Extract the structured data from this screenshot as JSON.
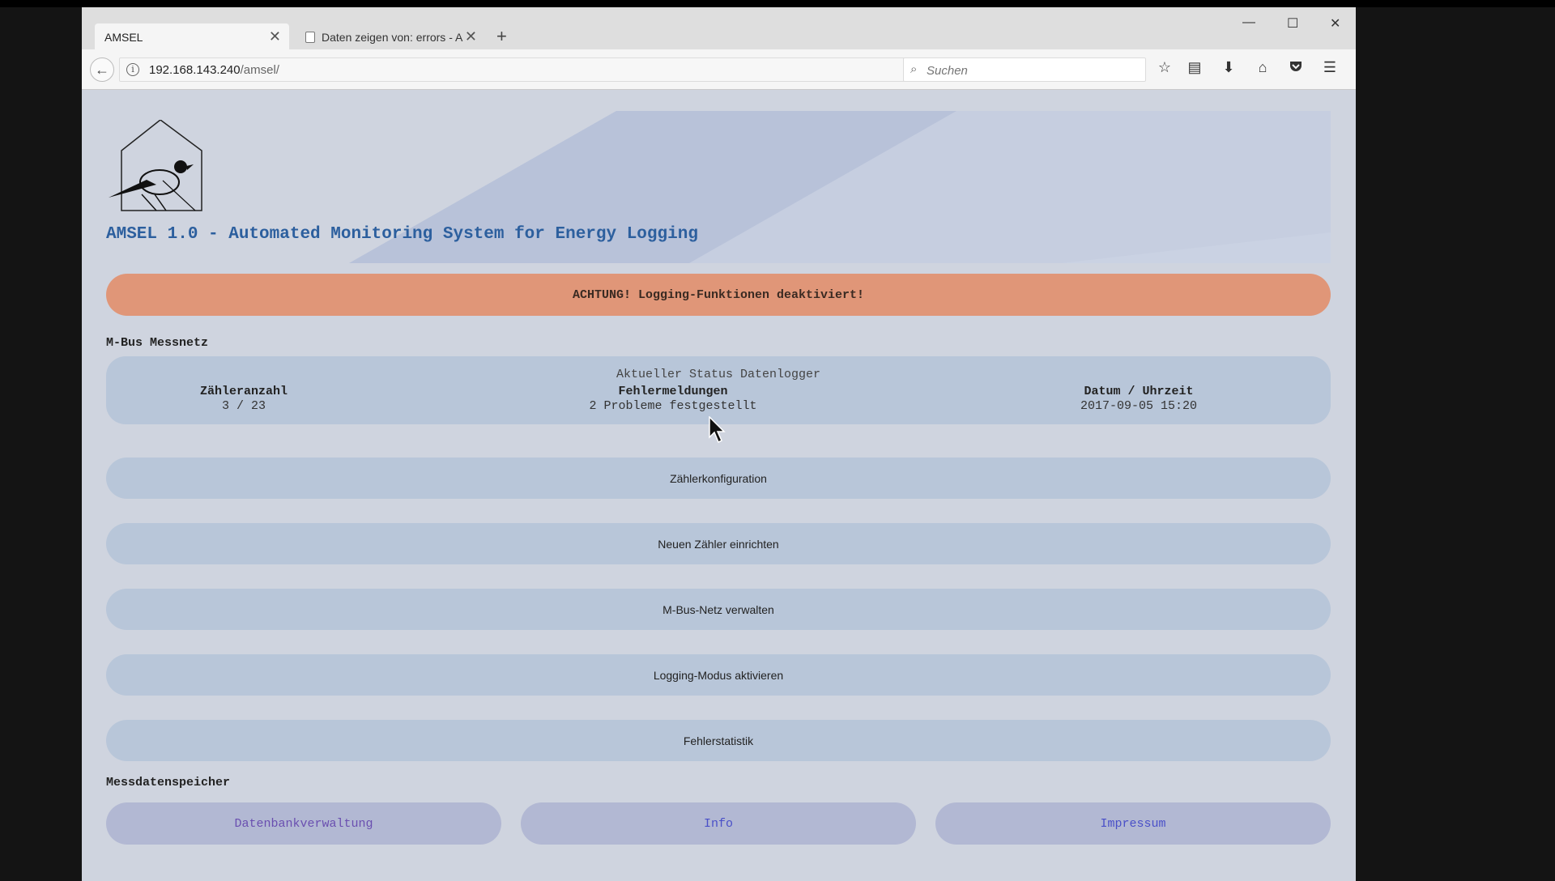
{
  "browser": {
    "tabs": [
      {
        "label": "AMSEL",
        "active": true
      },
      {
        "label": "Daten zeigen von: errors - A",
        "active": false
      }
    ],
    "new_tab_icon": "plus-icon",
    "url_host": "192.168.143.240",
    "url_path": "/amsel/",
    "search_placeholder": "Suchen",
    "window_controls": [
      "minimize",
      "maximize",
      "close"
    ],
    "toolbar_icons": [
      "bookmark-star-icon",
      "reading-list-icon",
      "download-icon",
      "home-icon",
      "pocket-icon",
      "menu-icon"
    ]
  },
  "header": {
    "title": "AMSEL 1.0 - Automated Monitoring System for Energy Logging"
  },
  "alert": {
    "text": "ACHTUNG! Logging-Funktionen deaktiviert!",
    "color": "#e09678"
  },
  "mbus": {
    "section_label": "M-Bus Messnetz",
    "status": {
      "title": "Aktueller Status Datenlogger",
      "counter_label": "Zähleranzahl",
      "counter_value": "3 / 23",
      "errors_label": "Fehlermeldungen",
      "errors_value": "2 Probleme festgestellt",
      "datetime_label": "Datum / Uhrzeit",
      "datetime_value": "2017-09-05 15:20"
    },
    "menu": [
      {
        "label": "Zählerkonfiguration"
      },
      {
        "label": "Neuen Zähler einrichten"
      },
      {
        "label": "M-Bus-Netz verwalten"
      },
      {
        "label": "Logging-Modus aktivieren"
      },
      {
        "label": "Fehlerstatistik"
      }
    ]
  },
  "storage": {
    "section_label": "Messdatenspeicher",
    "links": [
      {
        "label": "Datenbankverwaltung"
      },
      {
        "label": "Info"
      },
      {
        "label": "Impressum"
      }
    ]
  },
  "colors": {
    "title": "#2c5f9e",
    "panel": "#b8c6d9",
    "footer_button": "#b2b8d3",
    "footer_link": "#4a50c8"
  }
}
